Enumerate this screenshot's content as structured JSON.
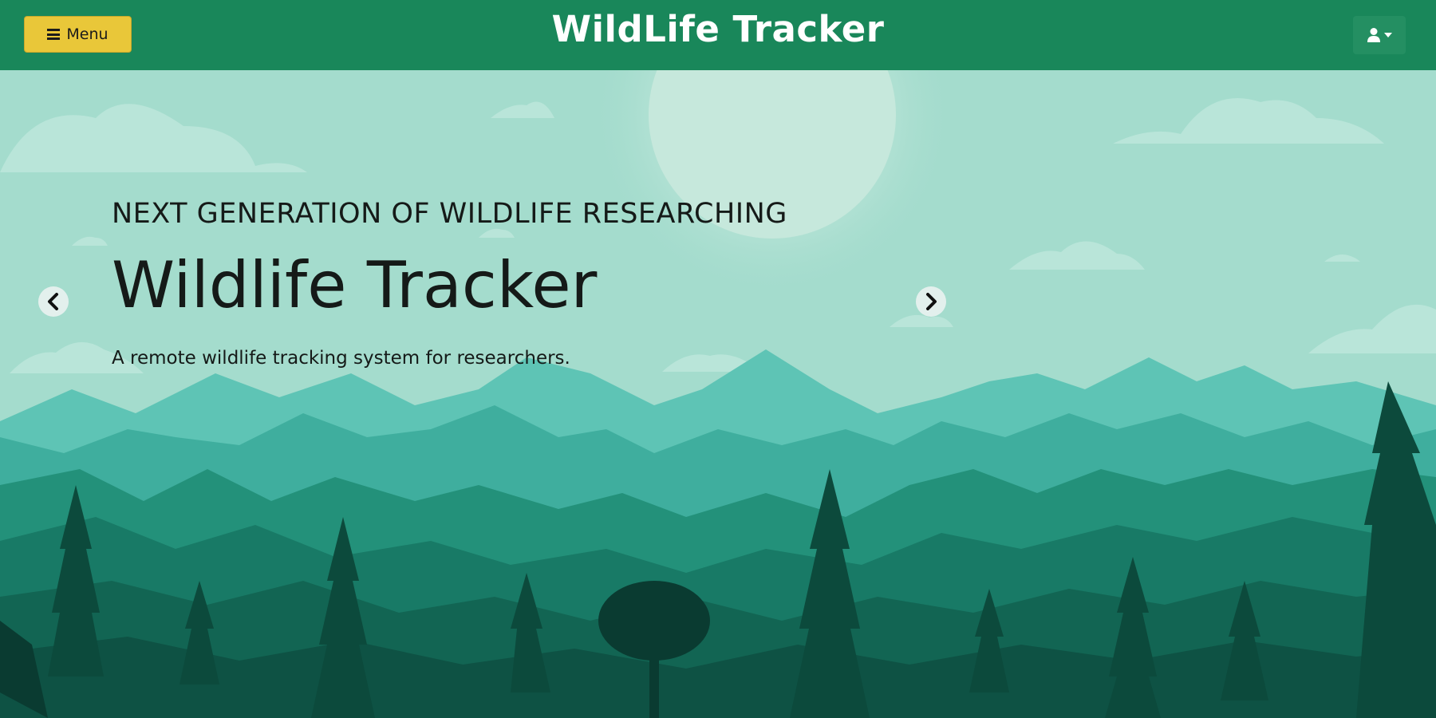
{
  "header": {
    "menu_label": "Menu",
    "brand": "WildLife Tracker",
    "user_icon": "user-icon"
  },
  "hero": {
    "eyebrow": "NEXT GENERATION OF WILDLIFE RESEARCHING",
    "title": "Wildlife Tracker",
    "subtitle": "A remote wildlife tracking system for researchers.",
    "prev_icon": "chevron-left-icon",
    "next_icon": "chevron-right-icon"
  },
  "colors": {
    "navbar": "#19875a",
    "menu_button": "#e9c739",
    "sky": "#a4dccd"
  }
}
